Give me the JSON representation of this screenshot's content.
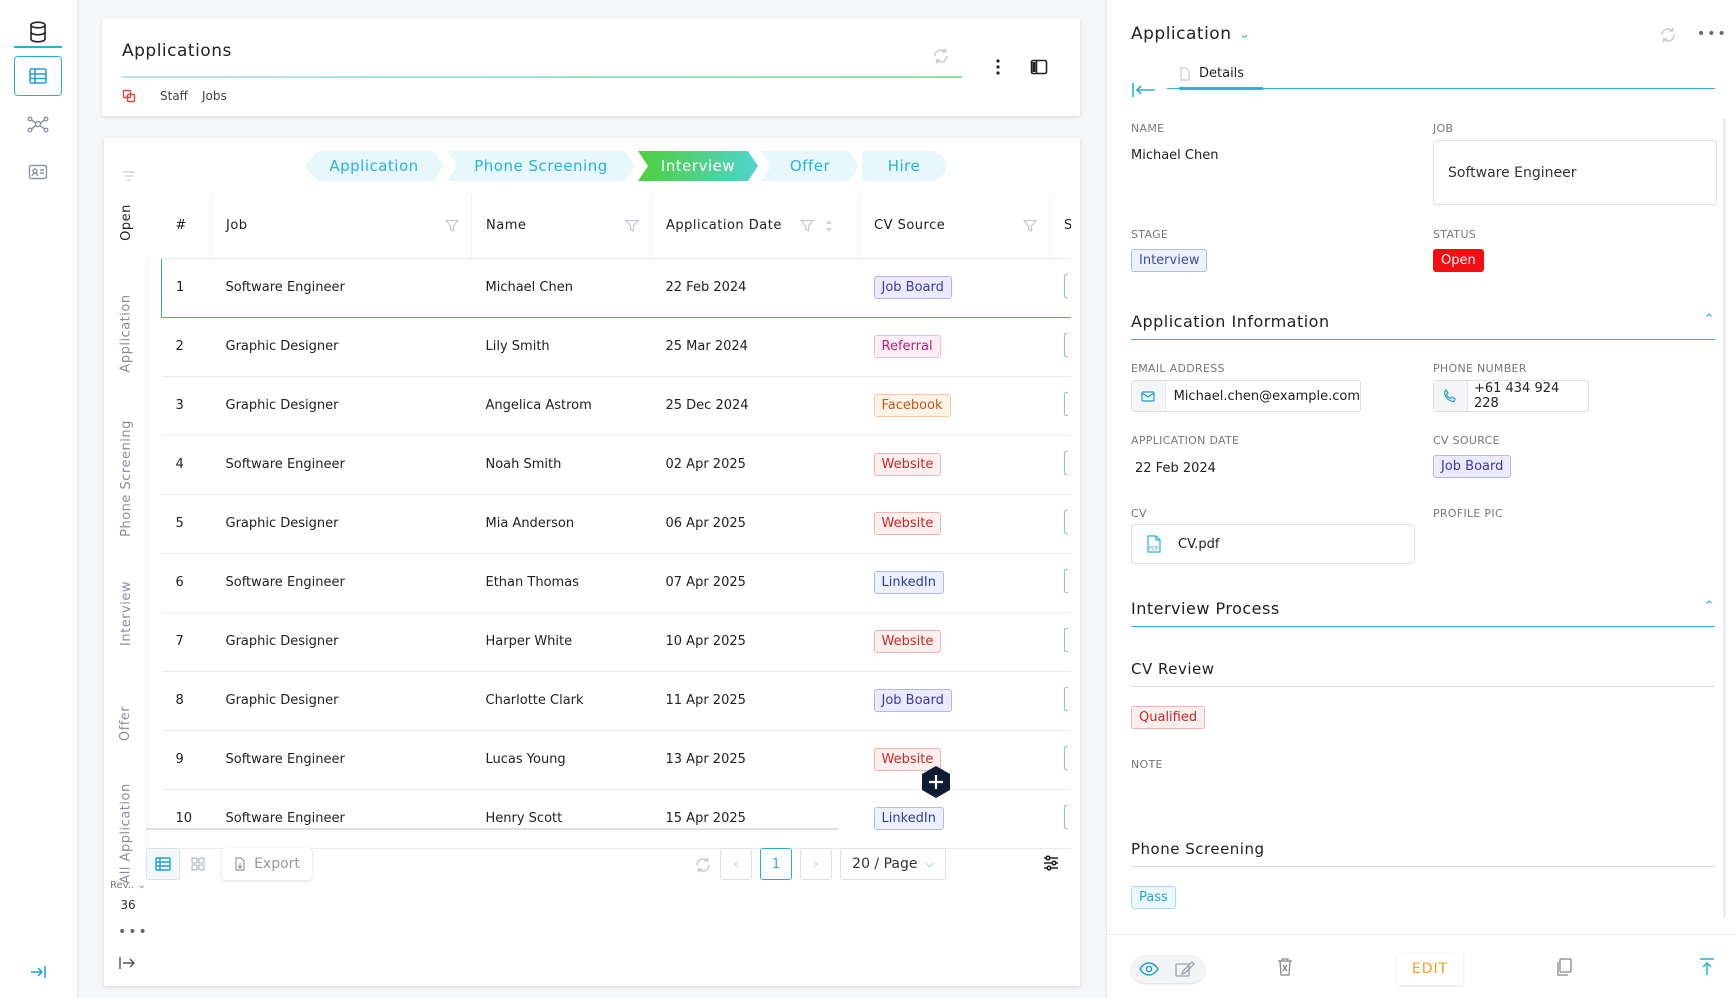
{
  "header": {
    "title": "Applications",
    "breadcrumbs": [
      "Staff",
      "Jobs"
    ]
  },
  "side_tabs": [
    "Open",
    "Application",
    "Phone Screening",
    "Interview",
    "Offer",
    "All Application"
  ],
  "side_footer": {
    "rev_label": "Rev..",
    "rev_value": "36"
  },
  "stages": [
    "Application",
    "Phone Screening",
    "Interview",
    "Offer",
    "Hire"
  ],
  "active_stage": "Interview",
  "columns": [
    "#",
    "Job",
    "Name",
    "Application Date",
    "CV Source"
  ],
  "rows": [
    {
      "n": "1",
      "job": "Software Engineer",
      "name": "Michael Chen",
      "date": "22 Feb 2024",
      "source": "Job Board"
    },
    {
      "n": "2",
      "job": "Graphic Designer",
      "name": "Lily Smith",
      "date": "25 Mar 2024",
      "source": "Referral"
    },
    {
      "n": "3",
      "job": "Graphic Designer",
      "name": "Angelica Astrom",
      "date": "25 Dec 2024",
      "source": "Facebook"
    },
    {
      "n": "4",
      "job": "Software Engineer",
      "name": "Noah Smith",
      "date": "02 Apr 2025",
      "source": "Website"
    },
    {
      "n": "5",
      "job": "Graphic Designer",
      "name": "Mia Anderson",
      "date": "06 Apr 2025",
      "source": "Website"
    },
    {
      "n": "6",
      "job": "Software Engineer",
      "name": "Ethan Thomas",
      "date": "07 Apr 2025",
      "source": "LinkedIn"
    },
    {
      "n": "7",
      "job": "Graphic Designer",
      "name": "Harper White",
      "date": "10 Apr 2025",
      "source": "Website"
    },
    {
      "n": "8",
      "job": "Graphic Designer",
      "name": "Charlotte Clark",
      "date": "11 Apr 2025",
      "source": "Job Board"
    },
    {
      "n": "9",
      "job": "Software Engineer",
      "name": "Lucas Young",
      "date": "13 Apr 2025",
      "source": "Website"
    },
    {
      "n": "10",
      "job": "Software Engineer",
      "name": "Henry Scott",
      "date": "15 Apr 2025",
      "source": "LinkedIn"
    }
  ],
  "source_colors": {
    "Job Board": {
      "fg": "#3b3aa8",
      "bg": "#eceaff",
      "bd": "#b7b3ef"
    },
    "Referral": {
      "fg": "#b0267a",
      "bg": "#fdeef6",
      "bd": "#f2b9d8"
    },
    "Facebook": {
      "fg": "#c4561d",
      "bg": "#fff3e8",
      "bd": "#f7c79f"
    },
    "Website": {
      "fg": "#c02b2b",
      "bg": "#fdeeee",
      "bd": "#f1b2b2"
    },
    "LinkedIn": {
      "fg": "#2a3f9c",
      "bg": "#eef1fd",
      "bd": "#aeb9ec"
    }
  },
  "footer": {
    "export_label": "Export",
    "page": "1",
    "page_size": "20 / Page"
  },
  "panel": {
    "title": "Application",
    "tab": "Details",
    "name_label": "NAME",
    "name": "Michael Chen",
    "job_label": "JOB",
    "job": "Software Engineer",
    "stage_label": "STAGE",
    "stage": "Interview",
    "status_label": "STATUS",
    "status": "Open",
    "app_info_title": "Application Information",
    "email_label": "EMAIL ADDRESS",
    "email": "Michael.chen@example.com",
    "phone_label": "PHONE NUMBER",
    "phone": "+61 434 924 228",
    "appdate_label": "APPLICATION DATE",
    "appdate": "22 Feb 2024",
    "cvsource_label": "CV SOURCE",
    "cvsource": "Job Board",
    "cv_label": "CV",
    "cv_file": "CV.pdf",
    "profile_label": "PROFILE PIC",
    "interview_title": "Interview Process",
    "cv_review_title": "CV Review",
    "cv_review_value": "Qualified",
    "note_label": "NOTE",
    "phone_screening_title": "Phone Screening",
    "phone_screening_value": "Pass",
    "edit_label": "EDIT"
  }
}
